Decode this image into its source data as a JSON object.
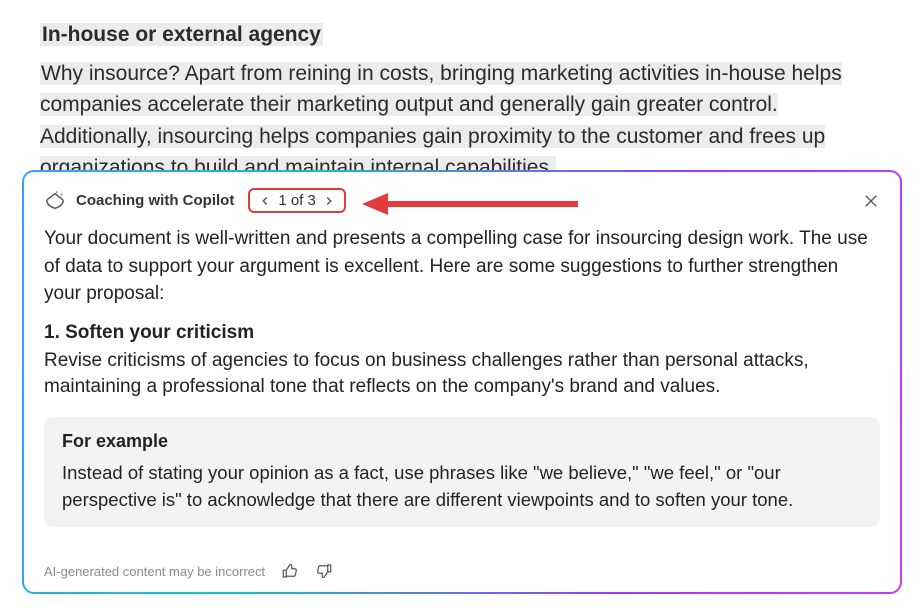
{
  "document": {
    "heading": "In-house or external agency",
    "body": "Why insource? Apart from reining in costs, bringing marketing activities in-house helps companies accelerate their marketing output and generally gain greater control. Additionally, insourcing helps companies gain proximity to the customer and frees up organizations to build and maintain internal capabilities."
  },
  "panel": {
    "title": "Coaching with Copilot",
    "pager": "1 of 3",
    "intro": "Your document is well-written and presents a compelling case for insourcing design work. The use of data to support your argument is excellent. Here are some suggestions to further strengthen your proposal:",
    "suggestion": {
      "title": "1. Soften your criticism",
      "body": "Revise criticisms of agencies to focus on business challenges rather than personal attacks, maintaining a professional tone that reflects on the company's brand and values."
    },
    "example": {
      "title": "For example",
      "body": "Instead of stating your opinion as a fact, use phrases like \"we believe,\" \"we feel,\" or \"our perspective is\" to acknowledge that there are different viewpoints and to soften your tone."
    },
    "disclaimer": "AI-generated content may be incorrect"
  }
}
